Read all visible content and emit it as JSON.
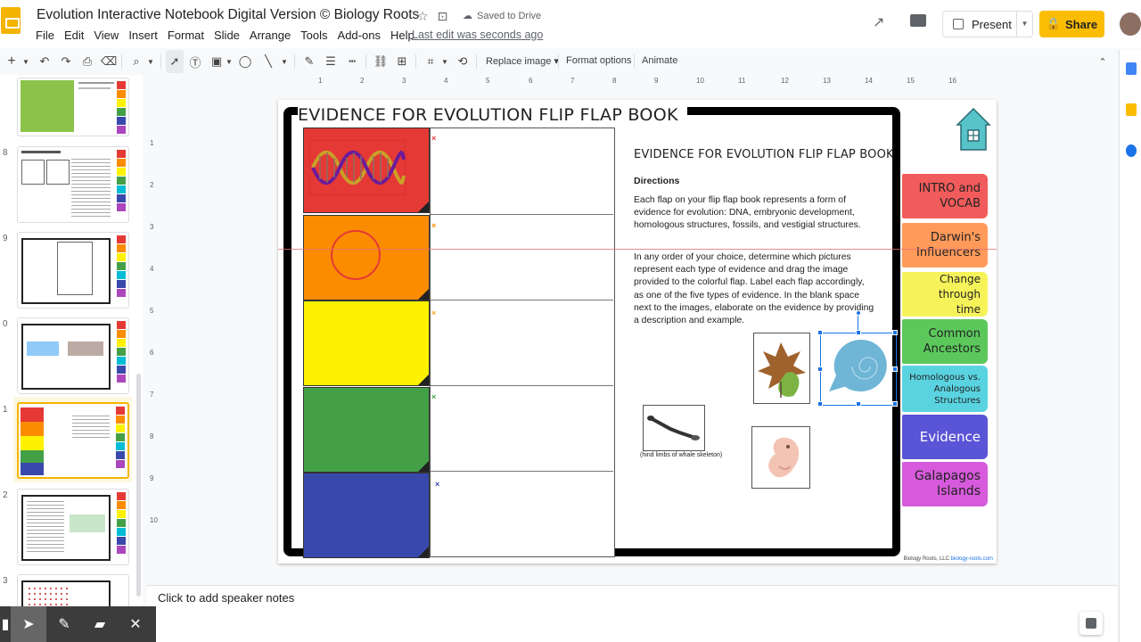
{
  "doc": {
    "title": "Evolution Interactive Notebook Digital Version © Biology Roots",
    "saved": "Saved to Drive",
    "last_edit": "Last edit was seconds ago"
  },
  "menu": [
    "File",
    "Edit",
    "View",
    "Insert",
    "Format",
    "Slide",
    "Arrange",
    "Tools",
    "Add-ons",
    "Help"
  ],
  "header_buttons": {
    "present": "Present",
    "share": "Share"
  },
  "toolbar": {
    "replace_image": "Replace image ▾",
    "format_options": "Format options",
    "animate": "Animate"
  },
  "filmstrip": {
    "numbers": [
      "8",
      "9",
      "0",
      "1",
      "2",
      "3"
    ]
  },
  "ruler": {
    "top": [
      "1",
      "2",
      "3",
      "4",
      "5",
      "6",
      "7",
      "8",
      "9",
      "10",
      "11",
      "12",
      "13",
      "14",
      "15",
      "16"
    ],
    "left": [
      "1",
      "2",
      "3",
      "4",
      "5",
      "6",
      "7",
      "8",
      "9",
      "10"
    ]
  },
  "slide": {
    "book_title": "EVIDENCE FOR EVOLUTION FLIP FLAP BOOK",
    "instructions_title": "EVIDENCE FOR EVOLUTION FLIP FLAP BOOK",
    "directions": "Directions",
    "paragraph1": "Each flap on your flip flap book represents a form of evidence for evolution: DNA, embryonic development, homologous structures, fossils, and vestigial structures.",
    "paragraph2": "In any order of your choice, determine which pictures represent each type of evidence and drag the image provided to the colorful flap. Label each flap accordingly, as one of the five types of evidence. In the blank space next to the images, elaborate on the evidence by providing a description and example.",
    "whale_caption": "(hind limbs of whale skeleton)",
    "credit_prefix": "Biology Roots, LLC ",
    "credit_link": "biology-roots.com",
    "flap_colors": [
      "#e53935",
      "#fb8c00",
      "#fff200",
      "#43a047",
      "#3949ab"
    ],
    "x_marks": [
      {
        "glyph": "×",
        "color": "#e53935"
      },
      {
        "glyph": "×",
        "color": "#fb8c00"
      },
      {
        "glyph": "×",
        "color": "#f9a825"
      },
      {
        "glyph": "×",
        "color": "#43a047"
      },
      {
        "glyph": "×",
        "color": "#3949ab"
      }
    ],
    "tabs": [
      {
        "line1": "INTRO and",
        "line2": "VOCAB",
        "color": "#f25b5b"
      },
      {
        "line1": "Darwin's",
        "line2": "Influencers",
        "color": "#ff9a5a"
      },
      {
        "line1": "Change through",
        "line2": "time",
        "color": "#f6f35a"
      },
      {
        "line1": "Common",
        "line2": "Ancestors",
        "color": "#5cc85c"
      },
      {
        "line1": "Homologous vs.",
        "line2": "Analogous",
        "line3": "Structures",
        "color": "#5ad3e0"
      },
      {
        "line1": "Evidence",
        "line2": "",
        "color": "#5a54d6"
      },
      {
        "line1": "Galapagos",
        "line2": "Islands",
        "color": "#d65adb"
      }
    ]
  },
  "notes": {
    "placeholder": "Click to add speaker notes"
  },
  "icons": [
    "slides-logo-icon",
    "star-icon",
    "folder-move-icon",
    "cloud-saved-icon",
    "activity-icon",
    "comment-icon",
    "present-icon",
    "lock-icon",
    "home-icon",
    "explore-icon",
    "pointer-icon",
    "pen-icon",
    "marker-icon",
    "close-icon"
  ]
}
